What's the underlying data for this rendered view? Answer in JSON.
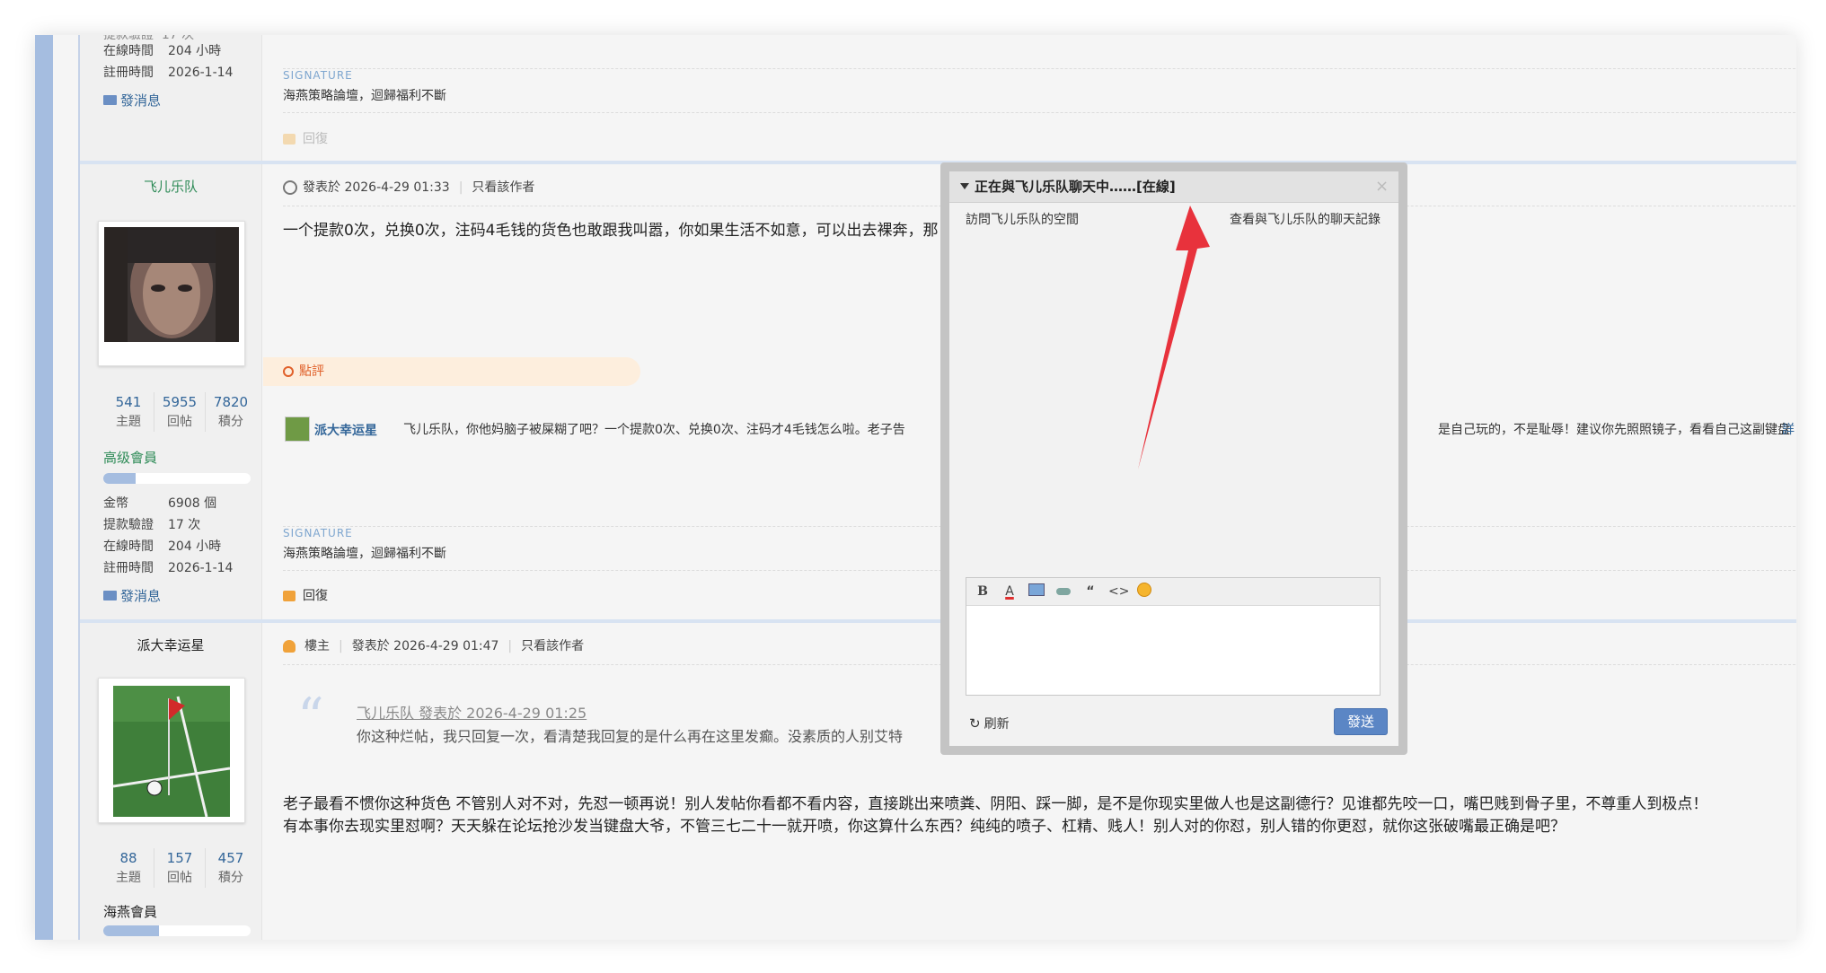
{
  "post0": {
    "stats": [
      {
        "label": "在線時間",
        "value": "204 小時"
      },
      {
        "label": "註冊時間",
        "value": "2026-1-14"
      }
    ],
    "send_msg": "發消息",
    "signature_label": "SIGNATURE",
    "signature_text": "海燕策略論壇，迴歸福利不斷",
    "reply": "回復"
  },
  "post1": {
    "username": "飞儿乐队",
    "counts": [
      {
        "num": "541",
        "label": "主題"
      },
      {
        "num": "5955",
        "label": "回帖"
      },
      {
        "num": "7820",
        "label": "積分"
      }
    ],
    "level": "高级會員",
    "level_progress": 0.22,
    "stats": [
      {
        "label": "金幣",
        "value": "6908 個"
      },
      {
        "label": "提款驗證",
        "value": "17 次"
      },
      {
        "label": "在線時間",
        "value": "204 小時"
      },
      {
        "label": "註冊時間",
        "value": "2026-1-14"
      }
    ],
    "send_msg": "發消息",
    "posted_at": "發表於 2026-4-29 01:33",
    "only_author": "只看該作者",
    "content": "一个提款0次，兑换0次，注码4毛钱的货色也敢跟我叫嚣，你如果生活不如意，可以出去裸奔，那",
    "rate_label": "點評",
    "comment_user": "派大幸运星",
    "comment_text_left": "飞儿乐队，你他妈脑子被屎糊了吧？一个提款0次、兑换0次、注码才4毛钱怎么啦。老子告",
    "comment_text_right": "是自己玩的，不是耻辱！建议你先照照镜子，看看自己这副键盘",
    "comment_more": "詳",
    "signature_label": "SIGNATURE",
    "signature_text": "海燕策略論壇，迴歸福利不斷",
    "reply": "回復"
  },
  "post2": {
    "username": "派大幸运星",
    "counts": [
      {
        "num": "88",
        "label": "主題"
      },
      {
        "num": "157",
        "label": "回帖"
      },
      {
        "num": "457",
        "label": "積分"
      }
    ],
    "level": "海燕會員",
    "level_progress": 0.38,
    "op_badge": "樓主",
    "posted_at": "發表於 2026-4-29 01:47",
    "only_author": "只看該作者",
    "quote_author": "飞儿乐队 發表於 2026-4-29 01:25",
    "quote_text": "你这种烂帖，我只回复一次，看清楚我回复的是什么再在这里发癫。没素质的人别艾特",
    "content_line1": "老子最看不惯你这种货色 不管别人对不对，先怼一顿再说！别人发帖你看都不看内容，直接跳出来喷粪、阴阳、踩一脚，是不是你现实里做人也是这副德行？见谁都先咬一口，嘴巴贱到骨子里，不尊重人到极点！",
    "content_line2": "有本事你去现实里怼啊？天天躲在论坛抢沙发当键盘大爷，不管三七二十一就开喷，你这算什么东西？纯纯的喷子、杠精、贱人！别人对的你怼，别人错的你更怼，就你这张破嘴最正确是吧？"
  },
  "chat": {
    "title": "正在與飞儿乐队聊天中……[在線]",
    "visit_space": "訪問飞儿乐队的空間",
    "view_history": "查看與飞儿乐队的聊天記錄",
    "refresh": "刷新",
    "send": "發送",
    "toolbar_icons": [
      "bold-icon",
      "font-color-icon",
      "image-icon",
      "link-icon",
      "quote-icon",
      "code-icon",
      "emoji-icon"
    ]
  },
  "colors": {
    "accent_blue": "#336699",
    "arrow_red": "#e8323c",
    "sidebar_blue": "#a5bde0"
  }
}
